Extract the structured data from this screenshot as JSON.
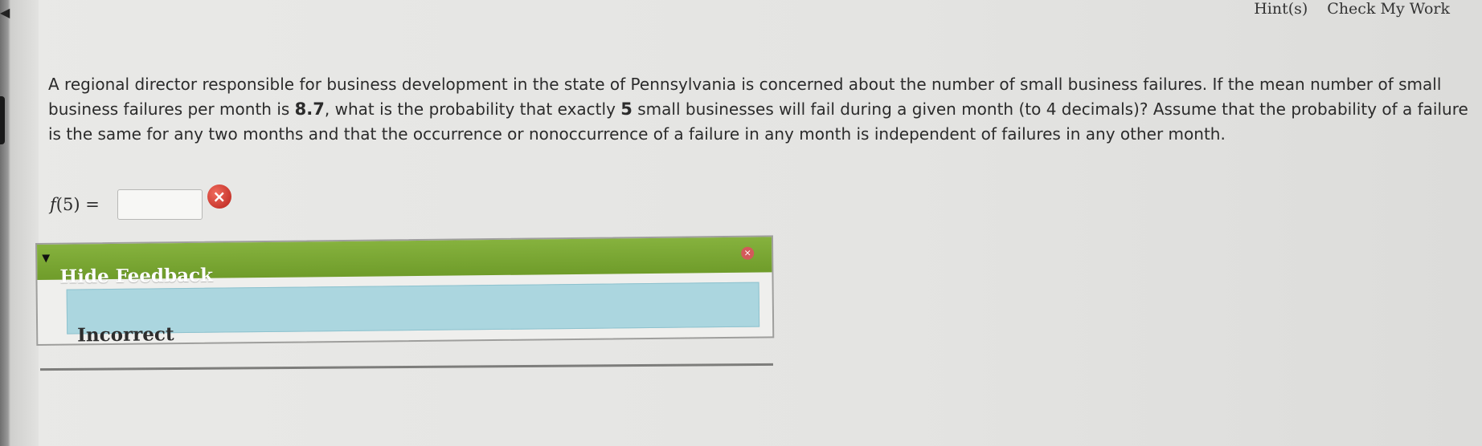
{
  "header": {
    "hints_label": "Hint(s)",
    "check_label": "Check My Work"
  },
  "question": {
    "part1": "A regional director responsible for business development in the state of Pennsylvania is concerned about the number of small business failures. If the mean number of small business failures per month is ",
    "mean_value": "8.7",
    "part2": ", what is the probability that exactly ",
    "count_value": "5",
    "part3": " small businesses will fail during a given month (to 4 decimals)? Assume that the probability of a failure is the same for any two months and that the occurrence or nonoccurrence of a failure in any month is independent of failures in any other month."
  },
  "answer": {
    "label_func": "f",
    "label_arg": "(5) =",
    "value": "",
    "status_icon": "x-circle-icon"
  },
  "feedback": {
    "toggle_label": "Hide Feedback",
    "status_text": "Incorrect",
    "toggle_icon": "triangle-down-icon",
    "close_icon": "x-circle-icon",
    "header_color": "#78a532",
    "body_color": "#abd6df"
  }
}
